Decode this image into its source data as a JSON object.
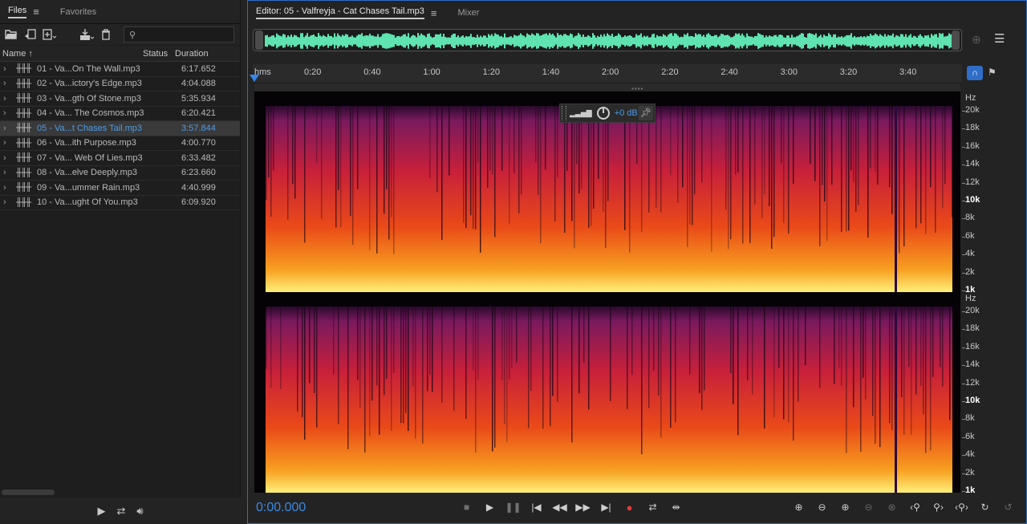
{
  "files_panel": {
    "tabs": [
      {
        "label": "Files",
        "active": true
      },
      {
        "label": "Favorites",
        "active": false
      }
    ],
    "search": {
      "value": "",
      "placeholder": ""
    },
    "columns": {
      "name": "Name",
      "status": "Status",
      "duration": "Duration"
    },
    "files": [
      {
        "name": "01 - Va...On The Wall.mp3",
        "duration": "6:17.652"
      },
      {
        "name": "02 - Va...ictory's Edge.mp3",
        "duration": "4:04.088"
      },
      {
        "name": "03 - Va...gth Of Stone.mp3",
        "duration": "5:35.934"
      },
      {
        "name": "04 - Va... The Cosmos.mp3",
        "duration": "6:20.421"
      },
      {
        "name": "05 - Va...t Chases Tail.mp3",
        "duration": "3:57.844",
        "selected": true
      },
      {
        "name": "06 - Va...ith Purpose.mp3",
        "duration": "4:00.770"
      },
      {
        "name": "07 - Va... Web Of Lies.mp3",
        "duration": "6:33.482"
      },
      {
        "name": "08 - Va...elve Deeply.mp3",
        "duration": "6:23.660"
      },
      {
        "name": "09 - Va...ummer Rain.mp3",
        "duration": "4:40.999"
      },
      {
        "name": "10 - Va...ught Of You.mp3",
        "duration": "6:09.920"
      }
    ]
  },
  "editor": {
    "tabs": [
      {
        "label": "Editor: 05 - Valfreyja - Cat Chases Tail.mp3",
        "active": true
      },
      {
        "label": "Mixer",
        "active": false
      }
    ],
    "ruler": {
      "unit_label": "hms",
      "ticks": [
        "0:20",
        "0:40",
        "1:00",
        "1:20",
        "1:40",
        "2:00",
        "2:20",
        "2:40",
        "3:00",
        "3:20",
        "3:40"
      ]
    },
    "hud": {
      "value": "+0 dB"
    },
    "hz_scale": {
      "unit": "Hz",
      "labels": [
        "20k",
        "18k",
        "16k",
        "14k",
        "12k",
        "10k",
        "8k",
        "6k",
        "4k",
        "2k",
        "1k"
      ]
    },
    "time_display": "0:00.000"
  },
  "colors": {
    "accent": "#3d8ae2",
    "waveform": "#5fe3b0",
    "record": "#e83a3a",
    "panel_bg": "#232323"
  }
}
